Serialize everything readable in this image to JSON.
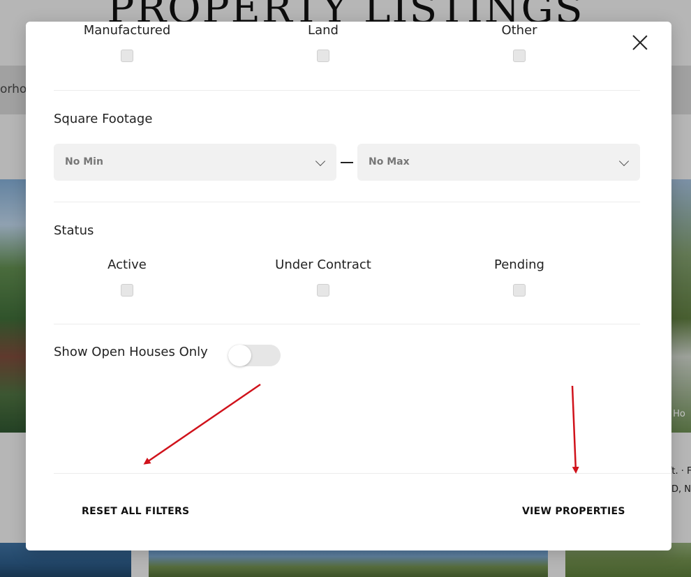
{
  "background": {
    "page_title": "PROPERTY LISTINGS",
    "filter_bar_text": "orhoo",
    "side_text_1": "ft. · F",
    "side_text_2": "D, N",
    "side_label": "e Ho"
  },
  "property_type": {
    "options": [
      {
        "label": "Manufactured",
        "checked": false
      },
      {
        "label": "Land",
        "checked": false
      },
      {
        "label": "Other",
        "checked": false
      }
    ]
  },
  "square_footage": {
    "title": "Square Footage",
    "min_value": "No Min",
    "max_value": "No Max"
  },
  "status": {
    "title": "Status",
    "options": [
      {
        "label": "Active",
        "checked": false
      },
      {
        "label": "Under Contract",
        "checked": false
      },
      {
        "label": "Pending",
        "checked": false
      }
    ]
  },
  "open_houses": {
    "label": "Show Open Houses Only",
    "enabled": false
  },
  "footer": {
    "reset_label": "RESET ALL FILTERS",
    "view_label": "VIEW PROPERTIES"
  },
  "colors": {
    "annotation_arrow": "#d0121b"
  },
  "icons": {
    "close": "close-icon",
    "dropdown": "chevron-down-icon"
  }
}
